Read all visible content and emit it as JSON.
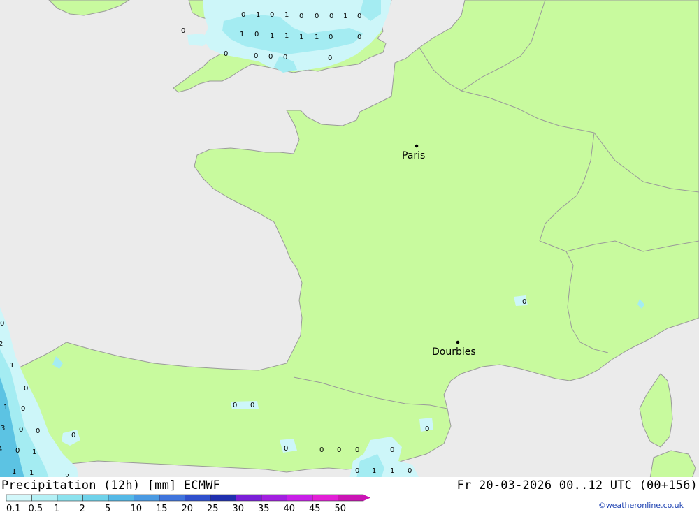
{
  "title": {
    "product": "Precipitation (12h) [mm] ECMWF",
    "valid": "Fr 20-03-2026 00..12 UTC (00+156)"
  },
  "credit": "©weatheronline.co.uk",
  "cities": [
    {
      "name": "Paris"
    },
    {
      "name": "Dourbies"
    }
  ],
  "colors": {
    "sea": "#ebebeb",
    "land": "#c8fa9e",
    "border": "#9a9a9a",
    "precip_light": "#cdf6f9",
    "precip_mid": "#a4ecf2",
    "precip_heavy": "#5cc3e3"
  },
  "legend": {
    "ticks": [
      "0.1",
      "0.5",
      "1",
      "2",
      "5",
      "10",
      "15",
      "20",
      "25",
      "30",
      "35",
      "40",
      "45",
      "50"
    ],
    "colors": [
      "#d2f7fa",
      "#b4f0f5",
      "#8ce2ee",
      "#6fd2ea",
      "#55b9e6",
      "#4a9ae2",
      "#3f74dc",
      "#2f4fcc",
      "#1f2fae",
      "#7a1fd8",
      "#a21fe0",
      "#c81fe8",
      "#e21fd6",
      "#ca14b4"
    ]
  },
  "values": {
    "england_row1": [
      "0",
      "1",
      "0",
      "1",
      "0",
      "0",
      "0",
      "1",
      "0"
    ],
    "england_row2": [
      "1",
      "0",
      "1",
      "1",
      "1",
      "1",
      "0",
      "0"
    ],
    "england_row3": [
      "0",
      "0",
      "0",
      "0",
      "0"
    ],
    "england_misc": [
      "0"
    ],
    "france_east": [
      "0"
    ],
    "atlantic_left": [
      "0",
      "2",
      "1",
      "0",
      "1",
      "0",
      "3",
      "0",
      "0",
      "4",
      "0",
      "1",
      "1",
      "1",
      "2"
    ],
    "spain_north": [
      "0",
      "0",
      "0",
      "0"
    ],
    "mediterranean": [
      "0",
      "0",
      "0",
      "0",
      "0",
      "0",
      "1",
      "1",
      "0"
    ]
  }
}
